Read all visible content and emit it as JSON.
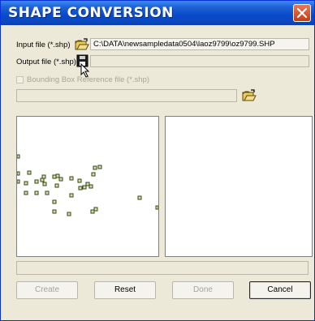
{
  "window": {
    "title": "SHAPE CONVERSION"
  },
  "input": {
    "label": "Input file (*.shp)",
    "value": "C:\\DATA\\newsampledata0504\\laoz9799\\oz9799.SHP"
  },
  "output": {
    "label": "Output file (*.shp)",
    "value": ""
  },
  "bbox": {
    "label": "Bounding Box Reference  file (*.shp)",
    "value": "",
    "checked": false
  },
  "buttons": {
    "create": "Create",
    "reset": "Reset",
    "done": "Done",
    "cancel": "Cancel"
  },
  "icons": {
    "open": "open-folder-icon",
    "save": "floppy-save-icon",
    "close": "close-icon"
  },
  "colors": {
    "titlebar": "#0a49c9",
    "close": "#d8532b",
    "window": "#ece9d8"
  }
}
